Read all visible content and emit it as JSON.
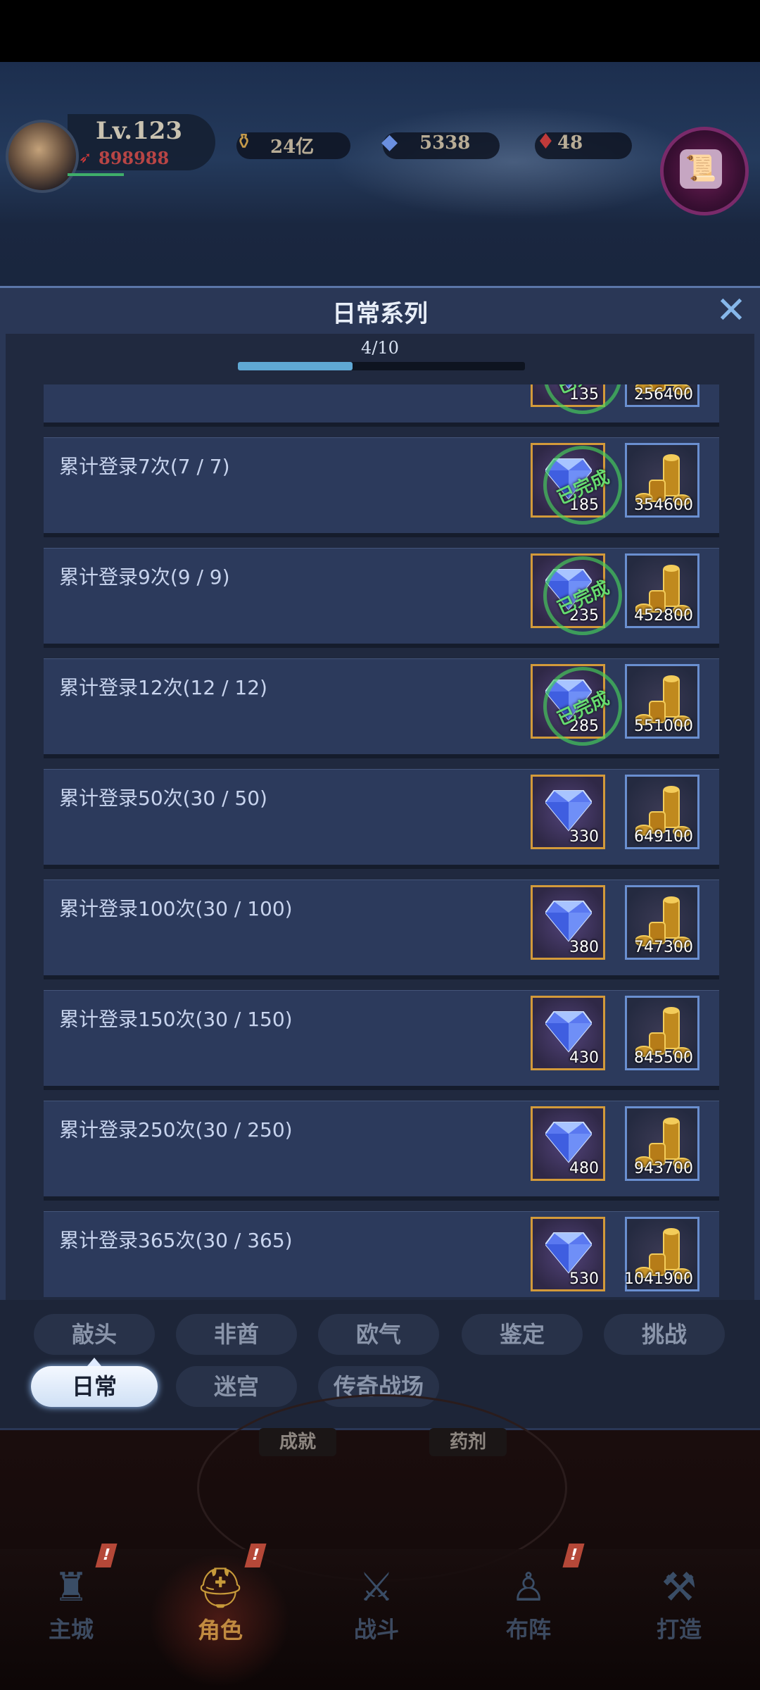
{
  "hud": {
    "level": "Lv.123",
    "power": "898988",
    "resources": [
      {
        "name": "gold-coin",
        "value": "24亿"
      },
      {
        "name": "diamond",
        "value": "5338"
      },
      {
        "name": "blood-crystal",
        "value": "48"
      }
    ]
  },
  "panel": {
    "title": "日常系列",
    "close": "✕",
    "progress_text": "4/10",
    "progress_fraction": 0.4
  },
  "stamp_text": "已完成",
  "tasks": [
    {
      "title": "",
      "gem": "135",
      "gold": "256400",
      "done": true
    },
    {
      "title": "累计登录7次(7 / 7)",
      "gem": "185",
      "gold": "354600",
      "done": true
    },
    {
      "title": "累计登录9次(9 / 9)",
      "gem": "235",
      "gold": "452800",
      "done": true
    },
    {
      "title": "累计登录12次(12 / 12)",
      "gem": "285",
      "gold": "551000",
      "done": true
    },
    {
      "title": "累计登录50次(30 / 50)",
      "gem": "330",
      "gold": "649100",
      "done": false
    },
    {
      "title": "累计登录100次(30 / 100)",
      "gem": "380",
      "gold": "747300",
      "done": false
    },
    {
      "title": "累计登录150次(30 / 150)",
      "gem": "430",
      "gold": "845500",
      "done": false
    },
    {
      "title": "累计登录250次(30 / 250)",
      "gem": "480",
      "gold": "943700",
      "done": false
    },
    {
      "title": "累计登录365次(30 / 365)",
      "gem": "530",
      "gold": "1041900",
      "done": false
    }
  ],
  "tabs": {
    "row1": [
      "敲头",
      "非酋",
      "欧气",
      "鉴定",
      "挑战"
    ],
    "row2": [
      "日常",
      "迷宫",
      "传奇战场"
    ],
    "active": "日常"
  },
  "lower_labels": [
    "成就",
    "药剂"
  ],
  "nav": [
    {
      "label": "主城",
      "icon": "castle-icon",
      "glyph": "♜"
    },
    {
      "label": "角色",
      "icon": "helmet-icon",
      "glyph": "⛑"
    },
    {
      "label": "战斗",
      "icon": "crossed-swords-icon",
      "glyph": "⚔"
    },
    {
      "label": "布阵",
      "icon": "formation-icon",
      "glyph": "♙"
    },
    {
      "label": "打造",
      "icon": "anvil-icon",
      "glyph": "⚒"
    }
  ],
  "nav_badge": "!",
  "active_nav": "角色"
}
